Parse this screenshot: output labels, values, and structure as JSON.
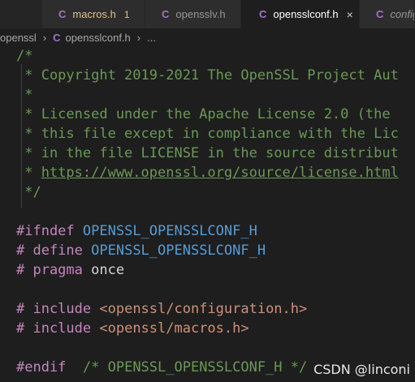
{
  "tabs": [
    {
      "label": "macros.h",
      "badge": "1",
      "icon": "c-file-icon",
      "active": false,
      "warn": true
    },
    {
      "label": "opensslv.h",
      "icon": "c-file-icon",
      "active": false
    },
    {
      "label": "opensslconf.h",
      "icon": "c-file-icon",
      "active": true,
      "close": "×"
    },
    {
      "label": "configu",
      "icon": "c-file-icon",
      "active": false,
      "italic": true
    }
  ],
  "breadcrumb": {
    "folder": "openssl",
    "sep1": "›",
    "file": "opensslconf.h",
    "sep2": "›",
    "more": "..."
  },
  "code": {
    "l1": "/*",
    "l2": " * Copyright 2019-2021 The OpenSSL Project Aut",
    "l3": " *",
    "l4": " * Licensed under the Apache License 2.0 (the",
    "l5": " * this file except in compliance with the Lic",
    "l6": " * in the file LICENSE in the source distribut",
    "l7a": " * ",
    "l7b": "https://www.openssl.org/source/license.html",
    "l8": " */",
    "ifndef_kw": "#ifndef",
    "ifndef_mac": "OPENSSL_OPENSSLCONF_H",
    "define_kw": "# define",
    "define_mac": "OPENSSL_OPENSSLCONF_H",
    "pragma_kw": "# pragma",
    "pragma_val": "once",
    "inc1_kw": "# include",
    "inc1_val": "<openssl/configuration.h>",
    "inc2_kw": "# include",
    "inc2_val": "<openssl/macros.h>",
    "endif_kw": "#endif",
    "endif_cmt": "/* OPENSSL_OPENSSLCONF_H */"
  },
  "watermark": "CSDN @linconi"
}
